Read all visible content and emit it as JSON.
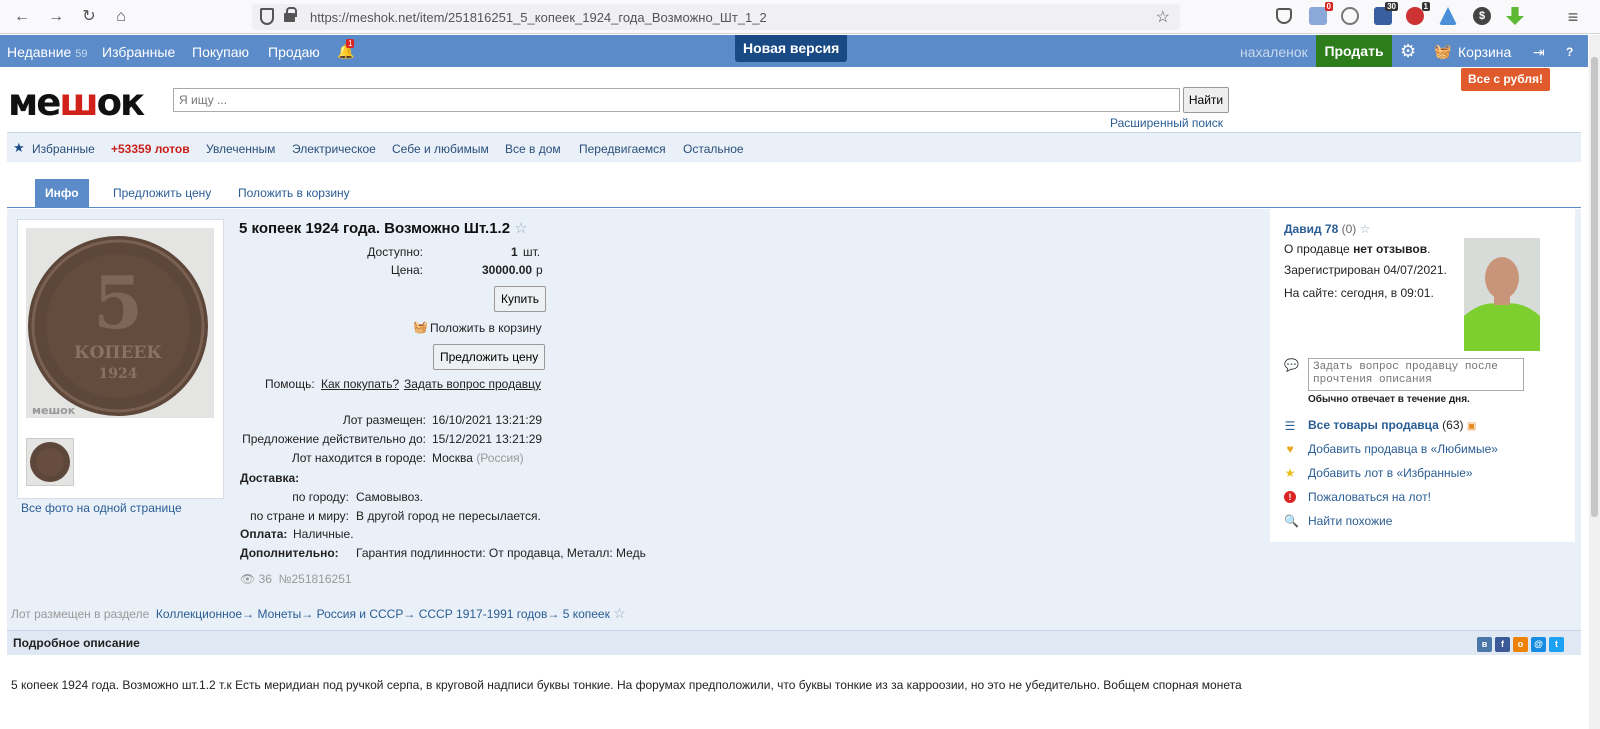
{
  "browser": {
    "url": "https://meshok.net/item/251816251_5_копеек_1924_года_Возможно_Шт_1_2",
    "ext_badges": [
      "0",
      "30",
      "1"
    ]
  },
  "topnav": {
    "recent": "Недавние",
    "recent_count": "59",
    "favorites": "Избранные",
    "buying": "Покупаю",
    "selling": "Продаю",
    "bell_count": "1",
    "new_version": "Новая версия",
    "username": "нахаленок",
    "sell": "Продать",
    "cart": "Корзина",
    "all_from_ruble": "Все с рубля!"
  },
  "logo": {
    "text_left": "ме",
    "text_hl": "ш",
    "text_right": "ок"
  },
  "search": {
    "placeholder": "Я ищу ...",
    "button": "Найти",
    "advanced": "Расширенный поиск"
  },
  "categories": {
    "favorites": "Избранные",
    "lots": "+53359 лотов",
    "items": [
      "Увлеченным",
      "Электрическое",
      "Себе и любимым",
      "Все в дом",
      "Передвигаемся",
      "Остальное"
    ]
  },
  "tabs": [
    "Инфо",
    "Предложить цену",
    "Положить в корзину"
  ],
  "photos": {
    "coin_num": "5",
    "coin_word": "КОПЕЕК",
    "coin_year": "1924",
    "watermark": "мешок",
    "all_photos": "Все фото на одной странице"
  },
  "lot": {
    "title": "5 копеек 1924 года. Возможно Шт.1.2",
    "available_label": "Доступно:",
    "available_value": "1",
    "available_unit": "шт.",
    "price_label": "Цена:",
    "price_value": "30000.00",
    "price_unit": "р",
    "buy": "Купить",
    "add_to_cart": "Положить в корзину",
    "offer_price": "Предложить цену",
    "help_label": "Помощь:",
    "help_how": "Как покупать?",
    "help_ask": "Задать вопрос продавцу",
    "placed_label": "Лот размещен:",
    "placed_value": "16/10/2021 13:21:29",
    "valid_label": "Предложение действительно до:",
    "valid_value": "15/12/2021 13:21:29",
    "city_label": "Лот находится в городе:",
    "city_value": "Москва",
    "country": "(Россия)",
    "delivery_label": "Доставка:",
    "by_city_label": "по городу:",
    "by_city_value": "Самовывоз.",
    "by_country_label": "по стране и миру:",
    "by_country_value": "В другой город не пересылается.",
    "payment_label": "Оплата:",
    "payment_value": "Наличные.",
    "extra_label": "Дополнительно:",
    "extra_value": "Гарантия подлинности: От продавца, Металл: Медь",
    "views": "36",
    "lot_id": "№251816251"
  },
  "seller": {
    "name": "Давид 78",
    "rating": "(0)",
    "reviews_prefix": "О продавце",
    "reviews_bold": "нет отзывов",
    "registered": "Зарегистрирован 04/07/2021.",
    "online": "На сайте: сегодня, в 09:01.",
    "ask_placeholder": "Задать вопрос продавцу после прочтения описания",
    "response_time": "Обычно отвечает в течение дня.",
    "all_items": "Все товары продавца",
    "all_items_count": "(63)",
    "add_favorite_seller": "Добавить продавца в «Любимые»",
    "add_favorite_lot": "Добавить лот в «Избранные»",
    "complain": "Пожаловаться на лот!",
    "find_similar": "Найти похожие"
  },
  "breadcrumbs": {
    "prefix": "Лот размещен в разделе",
    "items": [
      "Коллекционное",
      "Монеты",
      "Россия и СССР",
      "СССР 1917-1991 годов",
      "5 копеек"
    ]
  },
  "description": {
    "header": "Подробное описание",
    "text": "5 копеек 1924 года. Возможно шт.1.2 т.к Есть меридиан под ручкой серпа, в круговой надписи буквы тонкие. На форумах предположили, что буквы тонкие из за карроозии, но это не убедительно. Вобщем спорная монета"
  },
  "colors": {
    "nav": "#5b8bc8",
    "sell": "#2e7d1c",
    "accent": "#e05a2b",
    "link": "#2a5d94"
  }
}
